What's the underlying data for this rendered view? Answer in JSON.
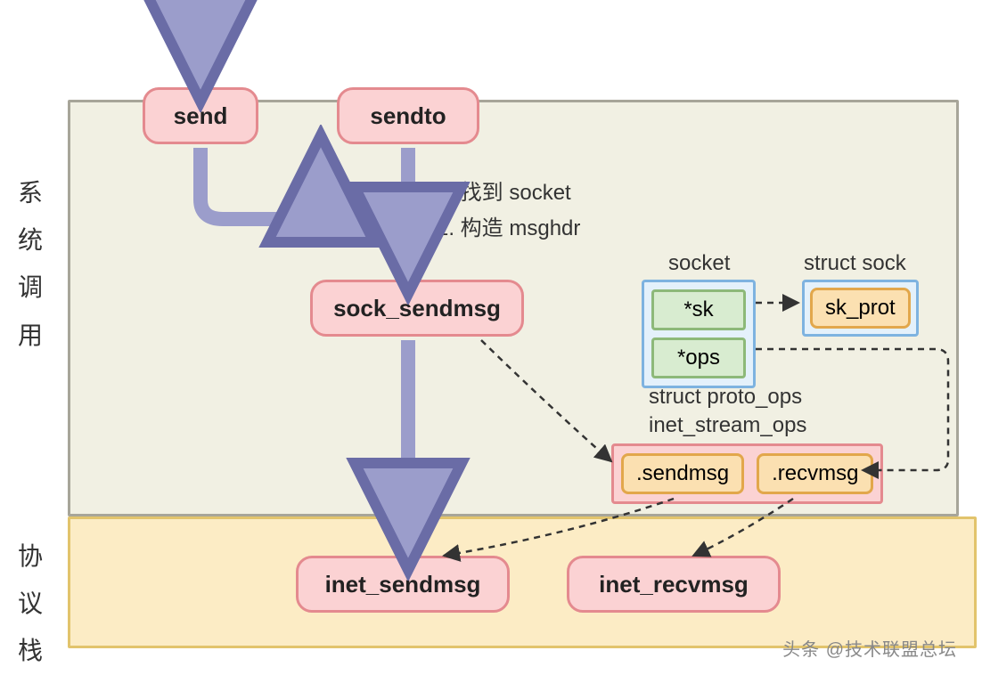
{
  "labels": {
    "zone_syscall": "系统调用",
    "zone_protocol": "协议栈"
  },
  "nodes": {
    "send": "send",
    "sendto": "sendto",
    "sock_sendmsg": "sock_sendmsg",
    "inet_sendmsg": "inet_sendmsg",
    "inet_recvmsg": "inet_recvmsg"
  },
  "annotations": {
    "step1": "1. 找到 socket",
    "step2": "2. 构造 msghdr"
  },
  "struct_titles": {
    "socket": "socket",
    "struct_sock": "struct sock",
    "proto_ops_1": "struct proto_ops",
    "proto_ops_2": "inet_stream_ops"
  },
  "fields": {
    "sk": "*sk",
    "ops": "*ops",
    "sk_prot": "sk_prot",
    "sendmsg": ".sendmsg",
    "recvmsg": ".recvmsg"
  },
  "watermark": "头条 @技术联盟总坛"
}
